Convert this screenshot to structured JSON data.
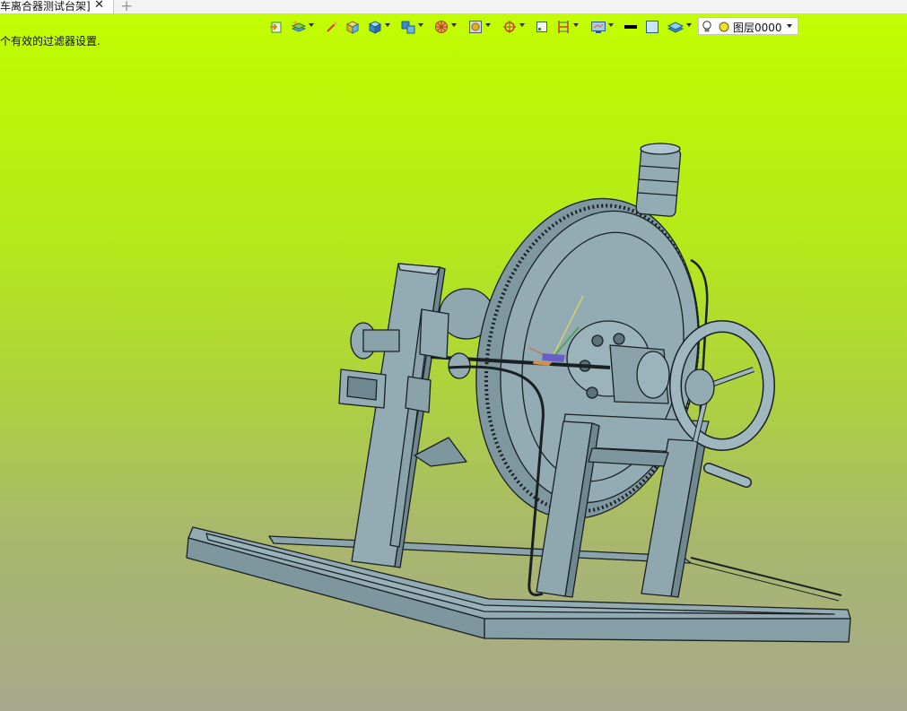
{
  "tab": {
    "title": "车离合器测试台架]",
    "close_glyph": "✕",
    "add_glyph": "+"
  },
  "status_message": "个有效的过滤器设置.",
  "toolbar": {
    "items": [
      "import-icon",
      "layer-manager-icon",
      "brush-icon",
      "cube-yellow-icon",
      "cube-blue-icon",
      "multi-cube-icon",
      "color-wheel-icon",
      "render-mode-icon",
      "snap-target-icon",
      "select-box-icon",
      "dimension-icon",
      "display-settings-icon",
      "line-color-icon",
      "fill-color-icon",
      "layer-stack-icon"
    ],
    "layer_combo": {
      "value": "图层0000",
      "bulb_icon": "lightbulb-icon",
      "color_icon": "layer-color-dot-icon"
    }
  },
  "colors": {
    "background_top": "#c4ff00",
    "background_bottom": "#a7a98d",
    "model_fill": "#8fa8b0",
    "model_edge": "#1a1f22"
  }
}
